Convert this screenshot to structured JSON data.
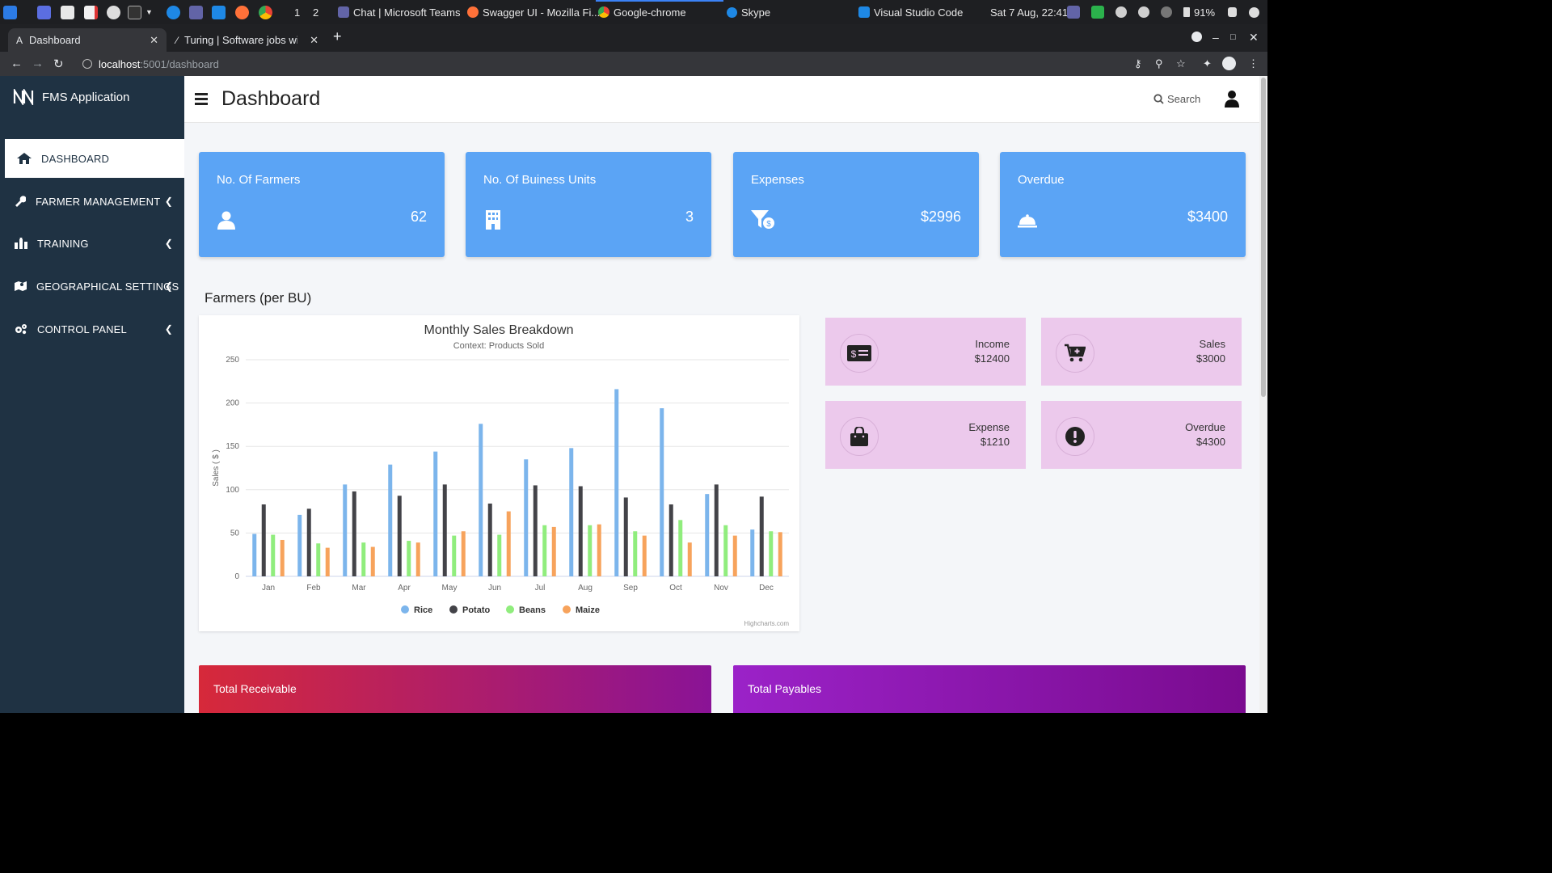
{
  "taskbar": {
    "workspaces": [
      "1",
      "2"
    ],
    "windows": [
      {
        "name": "teams",
        "label": "Chat | Microsoft Teams"
      },
      {
        "name": "firefox",
        "label": "Swagger UI - Mozilla Fi..."
      },
      {
        "name": "chrome",
        "label": "Google-chrome"
      },
      {
        "name": "skype",
        "label": "Skype"
      },
      {
        "name": "vscode",
        "label": "Visual Studio Code"
      }
    ],
    "clock": "Sat  7 Aug, 22:41",
    "battery": "91%"
  },
  "browser": {
    "tabs": [
      {
        "title": "Dashboard",
        "icon": "A"
      },
      {
        "title": "Turing | Software jobs wit",
        "icon": "⁄"
      }
    ],
    "url": {
      "host": "localhost",
      "path": ":5001/dashboard"
    }
  },
  "app": {
    "brand": "FMS Application",
    "menu": [
      {
        "label": "DASHBOARD",
        "icon": "home-icon"
      },
      {
        "label": "FARMER MANAGEMENT",
        "icon": "wrench-icon"
      },
      {
        "label": "TRAINING",
        "icon": "training-icon"
      },
      {
        "label": "GEOGRAPHICAL SETTINGS",
        "icon": "map-icon"
      },
      {
        "label": "CONTROL PANEL",
        "icon": "cogs-icon"
      }
    ],
    "page_title": "Dashboard",
    "search_label": "Search"
  },
  "stats": [
    {
      "label": "No. Of Farmers",
      "value": "62",
      "icon": "user-icon"
    },
    {
      "label": "No. Of Buiness Units",
      "value": "3",
      "icon": "building-icon"
    },
    {
      "label": "Expenses",
      "value": "$2996",
      "icon": "funnel-dollar-icon"
    },
    {
      "label": "Overdue",
      "value": "$3400",
      "icon": "bell-service-icon"
    }
  ],
  "section_title": "Farmers (per BU)",
  "mini_cards": [
    {
      "label": "Income",
      "value": "$12400",
      "icon": "money-check-icon"
    },
    {
      "label": "Sales",
      "value": "$3000",
      "icon": "cart-plus-icon"
    },
    {
      "label": "Expense",
      "value": "$1210",
      "icon": "shopping-bag-icon"
    },
    {
      "label": "Overdue",
      "value": "$4300",
      "icon": "exclamation-icon"
    }
  ],
  "totals": [
    {
      "label": "Total Receivable"
    },
    {
      "label": "Total Payables"
    }
  ],
  "colors": {
    "sidebar": "#1f3243",
    "stat_card": "#5ba4f5",
    "mini_card": "#ecc9ec",
    "receivable_gradient": [
      "#d6293a",
      "#8a1396"
    ],
    "payables_gradient": [
      "#9b22c8",
      "#7a0b8f"
    ]
  },
  "chart_data": {
    "type": "bar",
    "title": "Monthly Sales Breakdown",
    "subtitle": "Context: Products Sold",
    "ylabel": "Sales ( $ )",
    "xlabel": "",
    "ylim": [
      0,
      250
    ],
    "yticks": [
      0,
      50,
      100,
      150,
      200,
      250
    ],
    "grid": true,
    "legend": "bottom",
    "credits": "Highcharts.com",
    "categories": [
      "Jan",
      "Feb",
      "Mar",
      "Apr",
      "May",
      "Jun",
      "Jul",
      "Aug",
      "Sep",
      "Oct",
      "Nov",
      "Dec"
    ],
    "series": [
      {
        "name": "Rice",
        "color": "#7cb5ec",
        "values": [
          49,
          71,
          106,
          129,
          144,
          176,
          135,
          148,
          216,
          194,
          95,
          54
        ]
      },
      {
        "name": "Potato",
        "color": "#434348",
        "values": [
          83,
          78,
          98,
          93,
          106,
          84,
          105,
          104,
          91,
          83,
          106,
          92
        ]
      },
      {
        "name": "Beans",
        "color": "#90ed7d",
        "values": [
          48,
          38,
          39,
          41,
          47,
          48,
          59,
          59,
          52,
          65,
          59,
          52
        ]
      },
      {
        "name": "Maize",
        "color": "#f7a35c",
        "values": [
          42,
          33,
          34,
          39,
          52,
          75,
          57,
          60,
          47,
          39,
          47,
          51
        ]
      }
    ]
  }
}
